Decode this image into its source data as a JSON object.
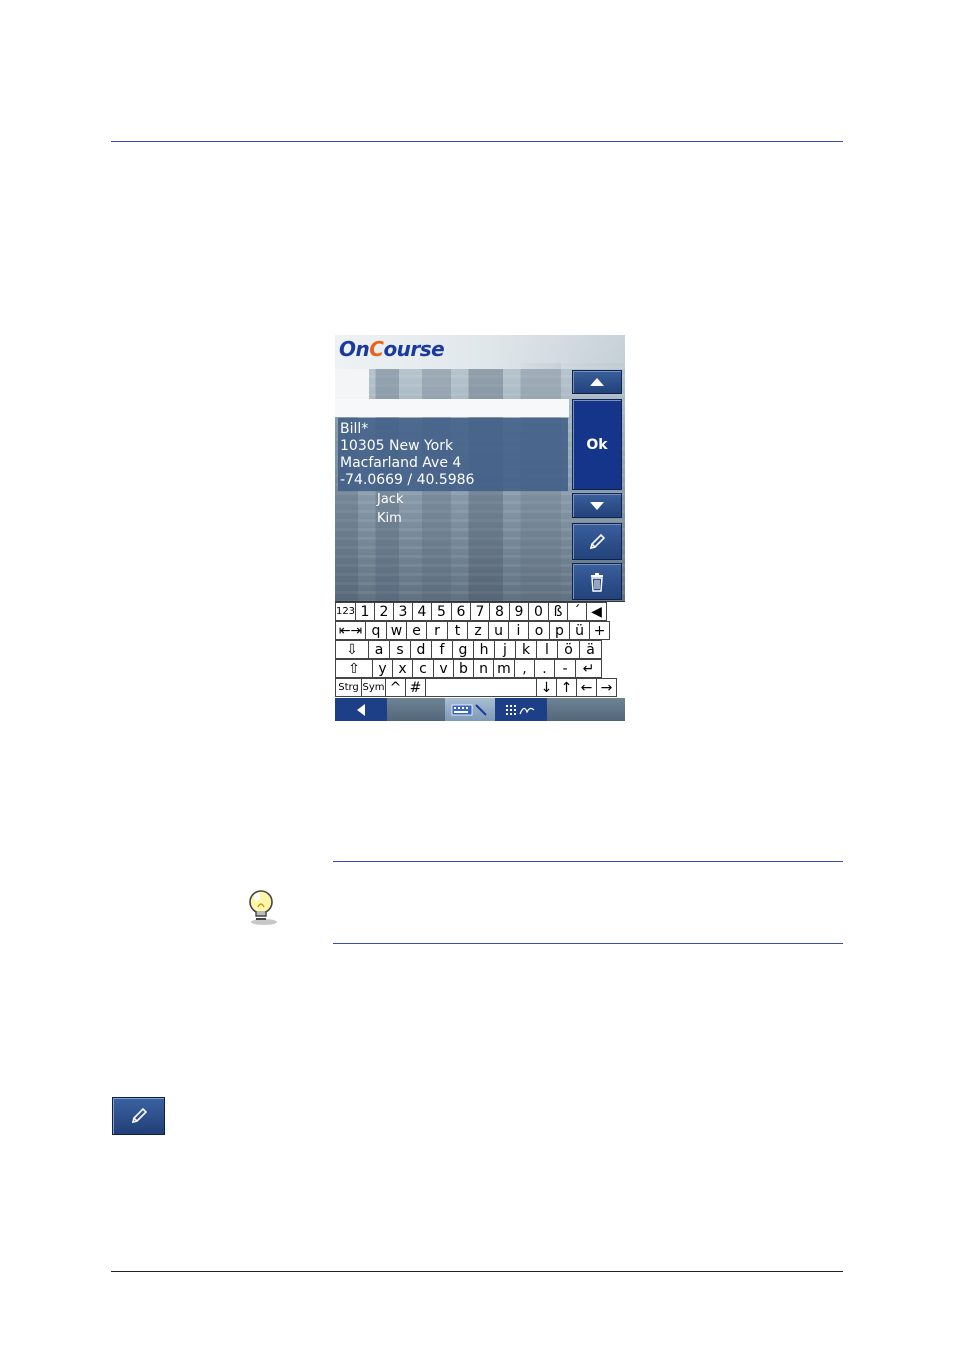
{
  "device": {
    "logo": {
      "on": "On",
      "c": "C",
      "ourse": "ourse"
    },
    "selected_entry": {
      "name": "Bill*",
      "address_line1": "10305 New York",
      "address_line2": "Macfarland Ave 4",
      "coordinates": "-74.0669 / 40.5986"
    },
    "list_items": [
      "Jack",
      "Kim"
    ],
    "ok_label": "Ok",
    "icons": {
      "up": "arrow-up-icon",
      "down": "arrow-down-icon",
      "edit": "pencil-icon",
      "delete": "trash-icon",
      "back": "back-arrow-icon",
      "keyboard": "keyboard-icon",
      "handwriting": "handwriting-icon"
    },
    "keyboard": {
      "row1": [
        "123",
        "1",
        "2",
        "3",
        "4",
        "5",
        "6",
        "7",
        "8",
        "9",
        "0",
        "ß",
        "´",
        "◀"
      ],
      "row2": [
        "⇤⇥",
        "q",
        "w",
        "e",
        "r",
        "t",
        "z",
        "u",
        "i",
        "o",
        "p",
        "ü",
        "+"
      ],
      "row3": [
        "⇩",
        "a",
        "s",
        "d",
        "f",
        "g",
        "h",
        "j",
        "k",
        "l",
        "ö",
        "ä"
      ],
      "row4": [
        "⇧",
        "y",
        "x",
        "c",
        "v",
        "b",
        "n",
        "m",
        ",",
        ".",
        "-",
        "↵"
      ],
      "row5": [
        "Strg",
        "Sym",
        "^",
        "#",
        " ",
        "↓",
        "↑",
        "←",
        "→"
      ]
    }
  },
  "colors": {
    "accent_blue": "#1b3a9e",
    "logo_orange": "#e8641b",
    "button_blue": "#22427a",
    "rule_blue": "#3b4fa8"
  },
  "tip_icon": "lightbulb-icon",
  "standalone_icon": "pencil-icon"
}
